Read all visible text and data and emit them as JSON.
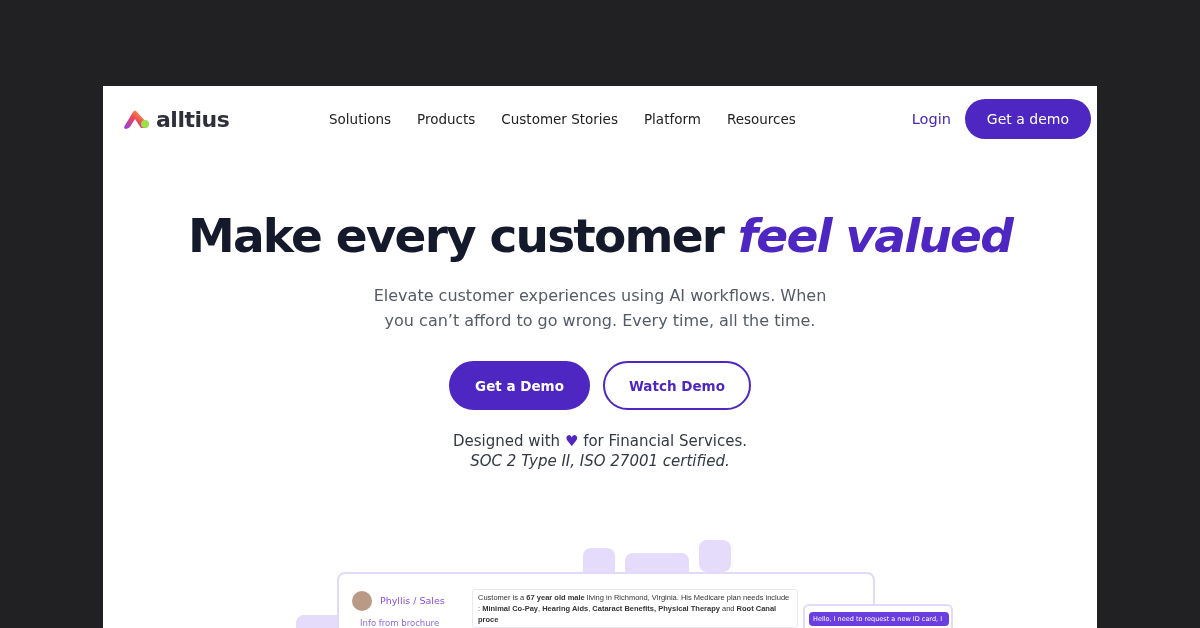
{
  "header": {
    "logo_text": "alltius",
    "nav": [
      {
        "label": "Solutions"
      },
      {
        "label": "Products"
      },
      {
        "label": "Customer Stories"
      },
      {
        "label": "Platform"
      },
      {
        "label": "Resources"
      }
    ],
    "login": "Login",
    "cta": "Get a demo"
  },
  "hero": {
    "title": "Make every customer",
    "title_highlight": "feel valued",
    "subtitle": "Elevate customer experiences using AI workflows. When you can’t afford to go wrong. Every time, all the time.",
    "buttons": [
      {
        "label": "Get a Demo",
        "kind": "primary"
      },
      {
        "label": "Watch Demo",
        "kind": "outline"
      }
    ],
    "tagline_before": "Designed with",
    "heart": "♥",
    "tagline_after": "for Financial Services.",
    "certification": "SOC 2 Type II, ISO 27001 certified."
  },
  "preview": {
    "agent": "Phyllis / Sales",
    "source_label": "Info from brochure",
    "customer_note": "Customer is a **67 year old male** living in Richmond, Virginia. His Medicare plan needs include : **Minimal Co-Pay**, **Hearing Aids**, **Cataract Benefits, Physical Therapy** and **Root Canal proce**",
    "chat_message": "Hello, I need to request a new ID card, I"
  }
}
